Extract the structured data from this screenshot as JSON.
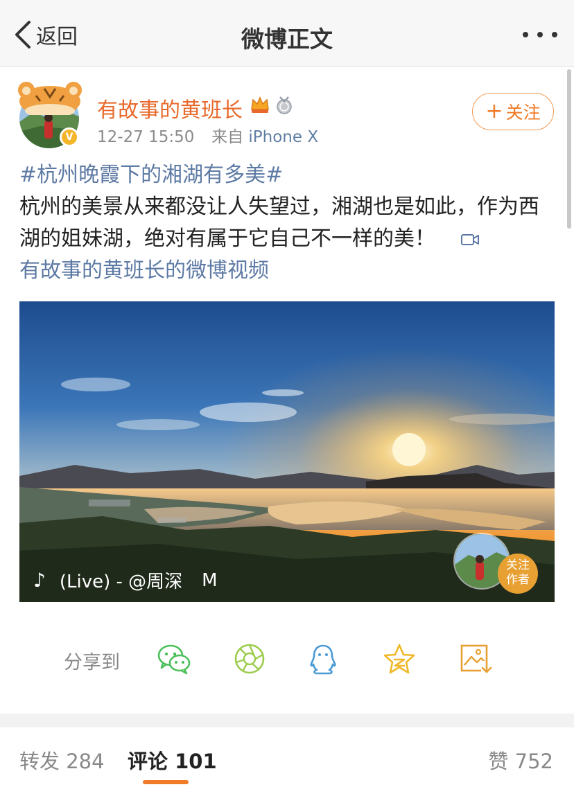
{
  "nav": {
    "back_label": "返回",
    "title": "微博正文"
  },
  "author": {
    "name": "有故事的黄班长",
    "verified_badge": "V",
    "time": "12-27 15:50",
    "source_prefix": "来自",
    "source": "iPhone X",
    "follow_label": "关注",
    "follow_plus": "+"
  },
  "post": {
    "topic": "#杭州晚霞下的湘湖有多美#",
    "text": "杭州的美景从来都没让人失望过，湘湖也是如此，作为西湖的姐妹湖，绝对有属于它自己不一样的美！",
    "video_link": "有故事的黄班长的微博视频"
  },
  "video": {
    "music_note": "♪",
    "music_text": "(Live) - @周深",
    "music_tail": "M",
    "follow_badge_line1": "关注",
    "follow_badge_line2": "作者"
  },
  "share": {
    "label": "分享到",
    "targets": [
      "wechat-icon",
      "moments-icon",
      "qq-icon",
      "qzone-icon",
      "save-image-icon"
    ]
  },
  "tabs": {
    "repost_label": "转发",
    "repost_count": "284",
    "comment_label": "评论",
    "comment_count": "101",
    "like_label": "赞",
    "like_count": "752"
  },
  "colors": {
    "accent": "#f07b28",
    "link": "#5d7aa4",
    "wechat": "#4cbf5a",
    "moments": "#9bcc4c",
    "qq": "#4a9ad4",
    "qzone": "#f0b828",
    "save": "#e8a032"
  }
}
